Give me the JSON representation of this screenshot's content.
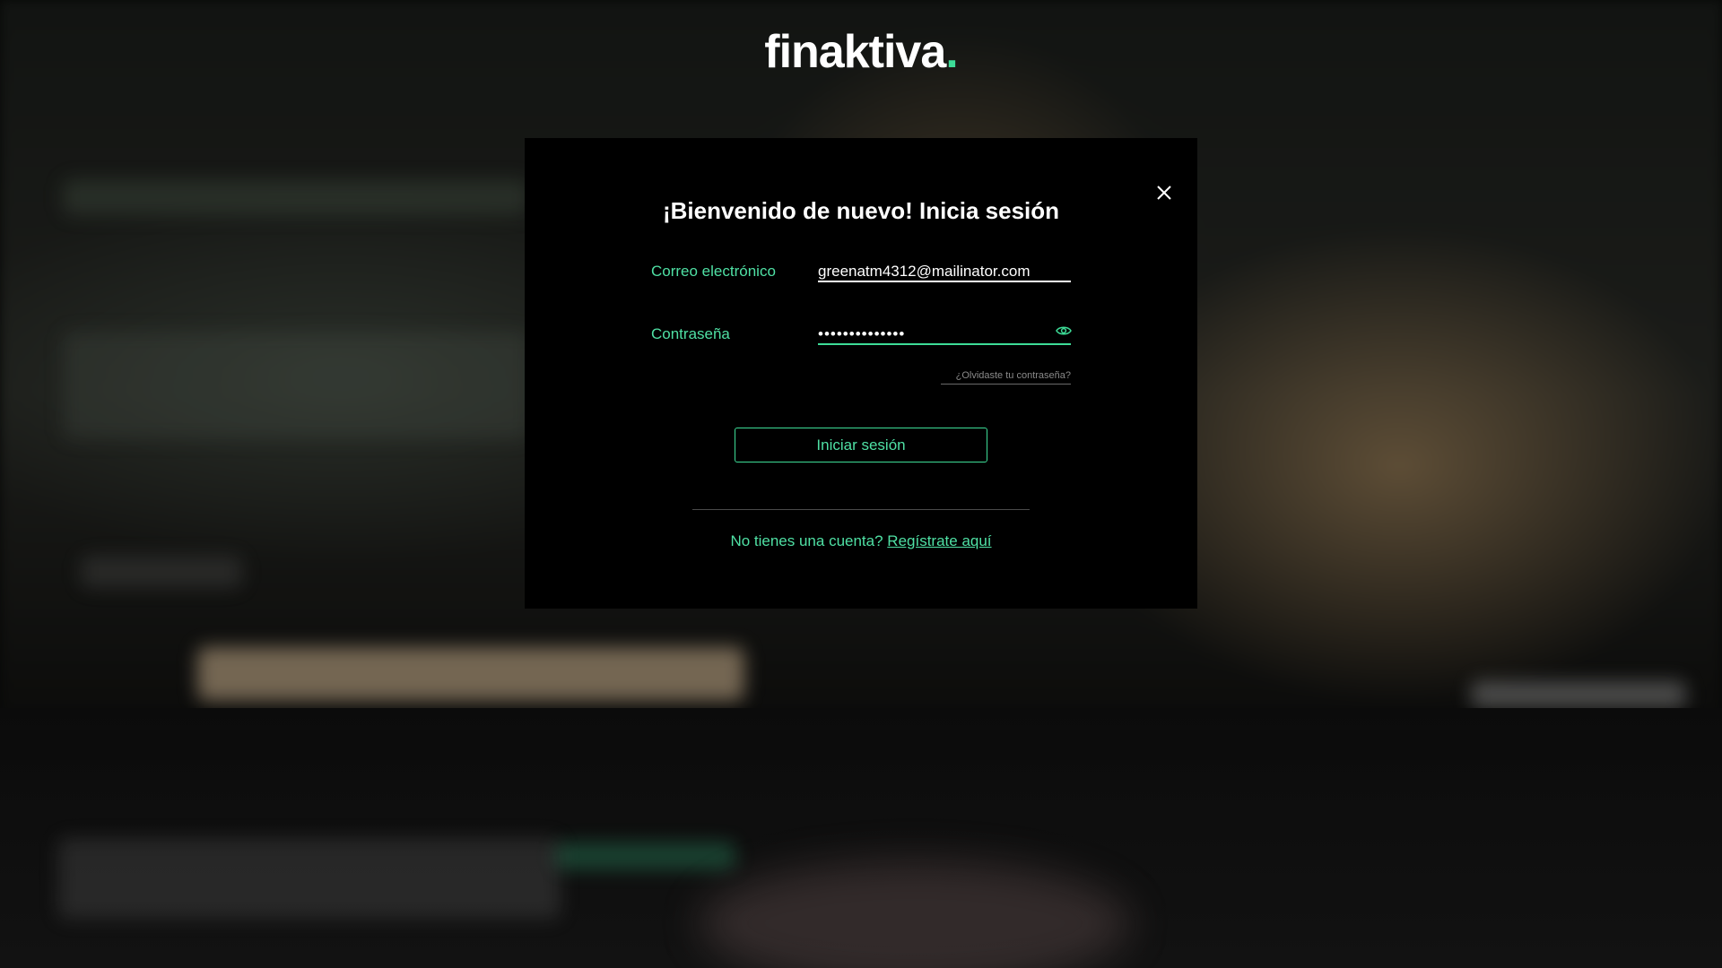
{
  "brand": {
    "logo_text": "finaktiva",
    "logo_dot": ".",
    "accent_color": "#3ddc97"
  },
  "modal": {
    "title": "¡Bienvenido de nuevo! Inicia sesión",
    "close_icon": "close-icon",
    "email": {
      "label": "Correo electrónico",
      "value": "greenatm4312@mailinator.com"
    },
    "password": {
      "label": "Contraseña",
      "value": "••••••••••••••",
      "toggle_icon": "eye-icon"
    },
    "forgot_password": "¿Olvidaste tu contraseña?",
    "login_button": "Iniciar sesión",
    "register_prompt": "No tienes una cuenta?",
    "register_link": "Regístrate aquí"
  }
}
